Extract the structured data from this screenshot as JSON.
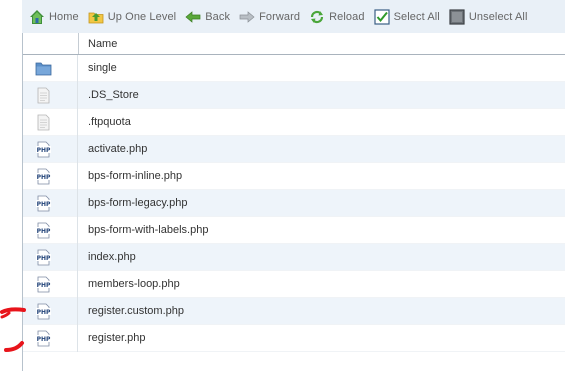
{
  "toolbar": {
    "home_label": "Home",
    "up_label": "Up One Level",
    "back_label": "Back",
    "forward_label": "Forward",
    "reload_label": "Reload",
    "select_all_label": "Select All",
    "unselect_all_label": "Unselect All"
  },
  "table": {
    "name_header": "Name",
    "rows": [
      {
        "name": "single",
        "icon": "folder-icon"
      },
      {
        "name": ".DS_Store",
        "icon": "generic-file-icon"
      },
      {
        "name": ".ftpquota",
        "icon": "generic-file-icon"
      },
      {
        "name": "activate.php",
        "icon": "php-file-icon"
      },
      {
        "name": "bps-form-inline.php",
        "icon": "php-file-icon"
      },
      {
        "name": "bps-form-legacy.php",
        "icon": "php-file-icon"
      },
      {
        "name": "bps-form-with-labels.php",
        "icon": "php-file-icon"
      },
      {
        "name": "index.php",
        "icon": "php-file-icon"
      },
      {
        "name": "members-loop.php",
        "icon": "php-file-icon"
      },
      {
        "name": "register.custom.php",
        "icon": "php-file-icon"
      },
      {
        "name": "register.php",
        "icon": "php-file-icon"
      }
    ]
  },
  "colors": {
    "toolbar_bg": "#e9f0f7",
    "row_alt_bg": "#eef4fa",
    "annotation_red": "#e8141b"
  }
}
